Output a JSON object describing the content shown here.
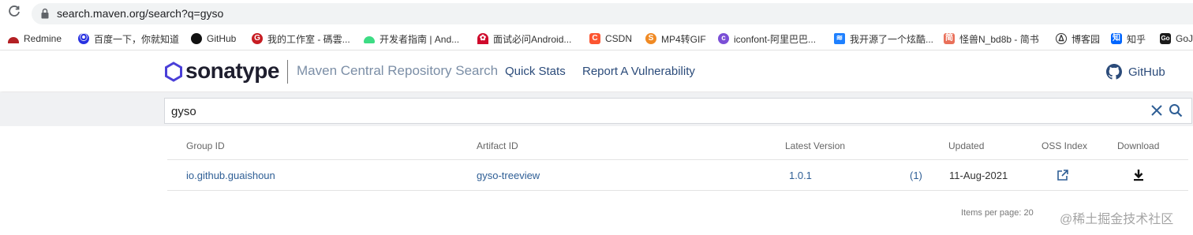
{
  "browser": {
    "url": "search.maven.org/search?q=gyso",
    "reload_icon": "reload-icon",
    "lock_icon": "lock-icon"
  },
  "bookmarks": [
    {
      "label": "Redmine",
      "icon": "redmine-icon",
      "color": "#b32024"
    },
    {
      "label": "百度一下，你就知道",
      "icon": "baidu-icon",
      "color": "#2932e1"
    },
    {
      "label": "GitHub",
      "icon": "github-icon",
      "color": "#111111"
    },
    {
      "label": "我的工作室 - 碼雲...",
      "icon": "gitee-icon",
      "color": "#c71d23"
    },
    {
      "label": "开发者指南 | And...",
      "icon": "android-icon",
      "color": "#3ddc84"
    },
    {
      "label": "面试必问Android...",
      "icon": "huawei-icon",
      "color": "#cf0a2c"
    },
    {
      "label": "CSDN",
      "icon": "csdn-icon",
      "color": "#fc5531"
    },
    {
      "label": "MP4转GIF",
      "icon": "mp4gif-icon",
      "color": "#f08a24"
    },
    {
      "label": "iconfont-阿里巴巴...",
      "icon": "iconfont-icon",
      "color": "#7b4fd6"
    },
    {
      "label": "我开源了一个炫酷...",
      "icon": "juejin-icon",
      "color": "#1e80ff"
    },
    {
      "label": "怪兽N_bd8b - 简书",
      "icon": "jianshu-icon",
      "color": "#e9705a"
    },
    {
      "label": "博客园",
      "icon": "cnblogs-icon",
      "color": "#333333"
    },
    {
      "label": "知乎",
      "icon": "zhihu-icon",
      "color": "#0066ff"
    },
    {
      "label": "GoJ",
      "icon": "go-icon",
      "color": "#1a1a1a"
    }
  ],
  "header": {
    "logo_text": "sonatype",
    "subtitle": "Maven Central Repository Search",
    "nav": [
      "Quick Stats",
      "Report A Vulnerability"
    ],
    "github_label": "GitHub"
  },
  "search": {
    "value": "gyso",
    "clear_icon": "close-icon",
    "search_icon": "search-icon"
  },
  "table": {
    "headers": [
      "Group ID",
      "Artifact ID",
      "Latest Version",
      "Updated",
      "OSS Index",
      "Download"
    ],
    "rows": [
      {
        "group_id": "io.github.guaishoun",
        "artifact_id": "gyso-treeview",
        "latest_version": "1.0.1",
        "version_count": "(1)",
        "updated": "11-Aug-2021",
        "oss_icon": "external-link-icon",
        "download_icon": "download-icon"
      }
    ]
  },
  "footer": {
    "items_per_page": "Items per page: 20",
    "watermark": "@稀土掘金技术社区"
  },
  "colors": {
    "link": "#2e5e95",
    "nav": "#2b4b7a",
    "logo_accent": "#4a3fd8"
  }
}
